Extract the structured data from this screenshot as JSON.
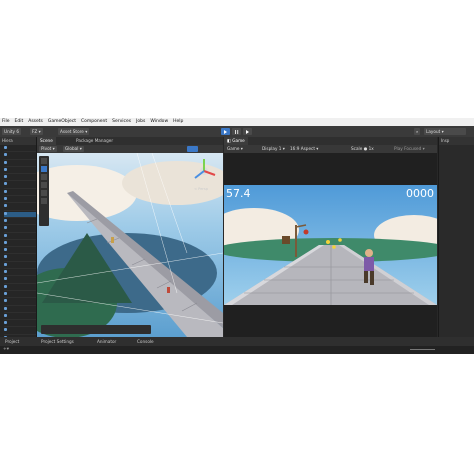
{
  "menu": [
    "File",
    "Edit",
    "Assets",
    "GameObject",
    "Component",
    "Services",
    "Jobs",
    "Window",
    "Help"
  ],
  "toolbar": {
    "app_label": "Unity 6",
    "account_label": "FZ",
    "asset_store_label": "Asset Store",
    "layout_label": "Layout"
  },
  "hierarchy": {
    "tab_label": "Hiera"
  },
  "scene": {
    "tabs": [
      "Scene",
      "Package Manager"
    ],
    "pivot_label": "Pivot",
    "global_label": "Global",
    "persp_label": "< Persp"
  },
  "game": {
    "tab_label": "Game",
    "mode_label": "Game",
    "display_label": "Display 1",
    "aspect_label": "16:9 Aspect",
    "scale_label": "Scale",
    "scale_value": "1x",
    "play_focused_label": "Play Focused",
    "timer": "57.4",
    "score": "0000"
  },
  "inspector": {
    "tab_label": "Insp"
  },
  "bottom_tabs": [
    "Project",
    "Project Settings",
    "Animator",
    "Console"
  ],
  "colors": {
    "accent": "#3b78c7",
    "editor_bg": "#282828",
    "sky": "#6fb3e6",
    "bridge": "#a8a8ae"
  }
}
